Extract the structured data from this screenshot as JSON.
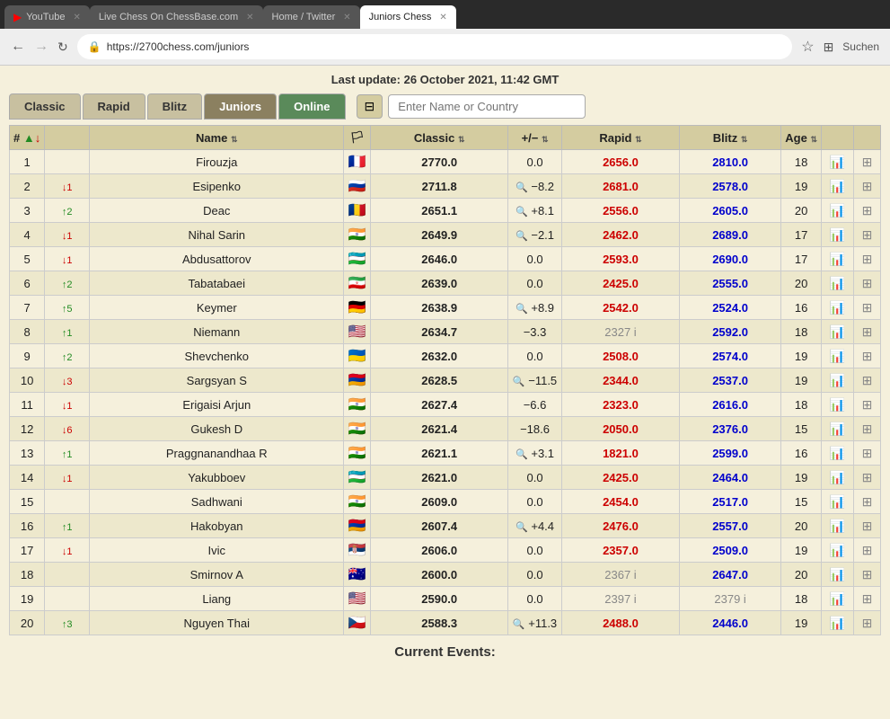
{
  "browser": {
    "tabs": [
      {
        "label": "YouTube",
        "active": false
      },
      {
        "label": "Live Chess On ChessBase.com",
        "active": false
      },
      {
        "label": "Home / Twitter",
        "active": false
      },
      {
        "label": "Juniors Chess",
        "active": true
      }
    ],
    "url": "https://2700chess.com/juniors",
    "search_placeholder": "Suchen"
  },
  "header": {
    "last_update": "Last update: 26 October 2021, 11:42 GMT"
  },
  "tabs": {
    "classic": "Classic",
    "rapid": "Rapid",
    "blitz": "Blitz",
    "juniors": "Juniors",
    "online": "Online"
  },
  "filter": {
    "icon": "⊟",
    "placeholder": "Enter Name or Country"
  },
  "table": {
    "headers": [
      "#",
      "↑↓",
      "Name",
      "🏳",
      "Classic",
      "+/−",
      "Rapid",
      "Blitz",
      "Age",
      "",
      ""
    ],
    "rows": [
      {
        "rank": 1,
        "change": "",
        "change_dir": "",
        "change_num": "",
        "name": "Firouzja",
        "flag": "🇫🇷",
        "classic": "2770.0",
        "diff": "0.0",
        "diff_type": "zero",
        "rapid": "2656.0",
        "rapid_inactive": false,
        "blitz": "2810.0",
        "age": 18,
        "has_search": false
      },
      {
        "rank": 2,
        "change": "↓1",
        "change_dir": "down",
        "change_num": "1",
        "name": "Esipenko",
        "flag": "🇷🇺",
        "classic": "2711.8",
        "diff": "−8.2",
        "diff_type": "neg",
        "rapid": "2681.0",
        "rapid_inactive": false,
        "blitz": "2578.0",
        "age": 19,
        "has_search": true
      },
      {
        "rank": 3,
        "change": "↑2",
        "change_dir": "up",
        "change_num": "2",
        "name": "Deac",
        "flag": "🇷🇴",
        "classic": "2651.1",
        "diff": "+8.1",
        "diff_type": "pos",
        "rapid": "2556.0",
        "rapid_inactive": false,
        "blitz": "2605.0",
        "age": 20,
        "has_search": true
      },
      {
        "rank": 4,
        "change": "↓1",
        "change_dir": "down",
        "change_num": "1",
        "name": "Nihal Sarin",
        "flag": "🇮🇳",
        "classic": "2649.9",
        "diff": "−2.1",
        "diff_type": "neg",
        "rapid": "2462.0",
        "rapid_inactive": false,
        "blitz": "2689.0",
        "age": 17,
        "has_search": true
      },
      {
        "rank": 5,
        "change": "↓1",
        "change_dir": "down",
        "change_num": "1",
        "name": "Abdusattorov",
        "flag": "🇺🇿",
        "classic": "2646.0",
        "diff": "0.0",
        "diff_type": "zero",
        "rapid": "2593.0",
        "rapid_inactive": false,
        "blitz": "2690.0",
        "age": 17,
        "has_search": false
      },
      {
        "rank": 6,
        "change": "↑2",
        "change_dir": "up",
        "change_num": "2",
        "name": "Tabatabaei",
        "flag": "🇮🇷",
        "classic": "2639.0",
        "diff": "0.0",
        "diff_type": "zero",
        "rapid": "2425.0",
        "rapid_inactive": false,
        "blitz": "2555.0",
        "age": 20,
        "has_search": false
      },
      {
        "rank": 7,
        "change": "↑5",
        "change_dir": "up",
        "change_num": "5",
        "name": "Keymer",
        "flag": "🇩🇪",
        "classic": "2638.9",
        "diff": "+8.9",
        "diff_type": "pos",
        "rapid": "2542.0",
        "rapid_inactive": false,
        "blitz": "2524.0",
        "age": 16,
        "has_search": true
      },
      {
        "rank": 8,
        "change": "↑1",
        "change_dir": "up",
        "change_num": "1",
        "name": "Niemann",
        "flag": "🇺🇸",
        "classic": "2634.7",
        "diff": "−3.3",
        "diff_type": "neg",
        "rapid": "2327 i",
        "rapid_inactive": true,
        "blitz": "2592.0",
        "age": 18,
        "has_search": false
      },
      {
        "rank": 9,
        "change": "↑2",
        "change_dir": "up",
        "change_num": "2",
        "name": "Shevchenko",
        "flag": "🇺🇦",
        "classic": "2632.0",
        "diff": "0.0",
        "diff_type": "zero",
        "rapid": "2508.0",
        "rapid_inactive": false,
        "blitz": "2574.0",
        "age": 19,
        "has_search": false
      },
      {
        "rank": 10,
        "change": "↓3",
        "change_dir": "down",
        "change_num": "3",
        "name": "Sargsyan S",
        "flag": "🇦🇲",
        "classic": "2628.5",
        "diff": "−11.5",
        "diff_type": "neg",
        "rapid": "2344.0",
        "rapid_inactive": false,
        "blitz": "2537.0",
        "age": 19,
        "has_search": true
      },
      {
        "rank": 11,
        "change": "↓1",
        "change_dir": "down",
        "change_num": "1",
        "name": "Erigaisi Arjun",
        "flag": "🇮🇳",
        "classic": "2627.4",
        "diff": "−6.6",
        "diff_type": "neg",
        "rapid": "2323.0",
        "rapid_inactive": false,
        "blitz": "2616.0",
        "age": 18,
        "has_search": false
      },
      {
        "rank": 12,
        "change": "↓6",
        "change_dir": "down",
        "change_num": "6",
        "name": "Gukesh D",
        "flag": "🇮🇳",
        "classic": "2621.4",
        "diff": "−18.6",
        "diff_type": "neg",
        "rapid": "2050.0",
        "rapid_inactive": false,
        "blitz": "2376.0",
        "age": 15,
        "has_search": false
      },
      {
        "rank": 13,
        "change": "↑1",
        "change_dir": "up",
        "change_num": "1",
        "name": "Praggnanandhaa R",
        "flag": "🇮🇳",
        "classic": "2621.1",
        "diff": "+3.1",
        "diff_type": "pos",
        "rapid": "1821.0",
        "rapid_inactive": false,
        "blitz": "2599.0",
        "age": 16,
        "has_search": true
      },
      {
        "rank": 14,
        "change": "↓1",
        "change_dir": "down",
        "change_num": "1",
        "name": "Yakubboev",
        "flag": "🇺🇿",
        "classic": "2621.0",
        "diff": "0.0",
        "diff_type": "zero",
        "rapid": "2425.0",
        "rapid_inactive": false,
        "blitz": "2464.0",
        "age": 19,
        "has_search": false
      },
      {
        "rank": 15,
        "change": "",
        "change_dir": "",
        "change_num": "",
        "name": "Sadhwani",
        "flag": "🇮🇳",
        "classic": "2609.0",
        "diff": "0.0",
        "diff_type": "zero",
        "rapid": "2454.0",
        "rapid_inactive": false,
        "blitz": "2517.0",
        "age": 15,
        "has_search": false
      },
      {
        "rank": 16,
        "change": "↑1",
        "change_dir": "up",
        "change_num": "1",
        "name": "Hakobyan",
        "flag": "🇦🇲",
        "classic": "2607.4",
        "diff": "+4.4",
        "diff_type": "pos",
        "rapid": "2476.0",
        "rapid_inactive": false,
        "blitz": "2557.0",
        "age": 20,
        "has_search": true
      },
      {
        "rank": 17,
        "change": "↓1",
        "change_dir": "down",
        "change_num": "1",
        "name": "Ivic",
        "flag": "🇷🇸",
        "classic": "2606.0",
        "diff": "0.0",
        "diff_type": "zero",
        "rapid": "2357.0",
        "rapid_inactive": false,
        "blitz": "2509.0",
        "age": 19,
        "has_search": false
      },
      {
        "rank": 18,
        "change": "",
        "change_dir": "",
        "change_num": "",
        "name": "Smirnov A",
        "flag": "🇦🇺",
        "classic": "2600.0",
        "diff": "0.0",
        "diff_type": "zero",
        "rapid": "2367 i",
        "rapid_inactive": true,
        "blitz": "2647.0",
        "age": 20,
        "has_search": false
      },
      {
        "rank": 19,
        "change": "",
        "change_dir": "",
        "change_num": "",
        "name": "Liang",
        "flag": "🇺🇸",
        "classic": "2590.0",
        "diff": "0.0",
        "diff_type": "zero",
        "rapid": "2397 i",
        "rapid_inactive": true,
        "blitz": "2379 i",
        "age": 18,
        "has_search": false
      },
      {
        "rank": 20,
        "change": "↑3",
        "change_dir": "up",
        "change_num": "3",
        "name": "Nguyen Thai",
        "flag": "🇨🇿",
        "classic": "2588.3",
        "diff": "+11.3",
        "diff_type": "pos",
        "rapid": "2488.0",
        "rapid_inactive": false,
        "blitz": "2446.0",
        "age": 19,
        "has_search": true
      }
    ]
  },
  "footer": {
    "current_events": "Current Events:"
  }
}
